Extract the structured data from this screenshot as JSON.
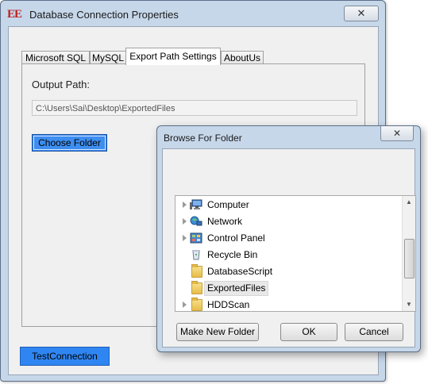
{
  "window": {
    "title": "Database Connection Properties",
    "app_icon_text": "EE",
    "close_glyph": "✕"
  },
  "tabs": [
    {
      "label": "Microsoft SQL"
    },
    {
      "label": "MySQL"
    },
    {
      "label": "Export Path Settings"
    },
    {
      "label": "AboutUs"
    }
  ],
  "export_panel": {
    "output_label": "Output Path:",
    "output_path": "C:\\Users\\Sai\\Desktop\\ExportedFiles",
    "choose_button": "Choose Folder"
  },
  "test_button": "TestConnection",
  "browse_dialog": {
    "title": "Browse For Folder",
    "close_glyph": "✕",
    "tree": [
      {
        "label": "Computer",
        "icon": "computer-icon",
        "expander": true
      },
      {
        "label": "Network",
        "icon": "network-icon",
        "expander": true
      },
      {
        "label": "Control Panel",
        "icon": "control-panel-icon",
        "expander": true
      },
      {
        "label": "Recycle Bin",
        "icon": "recycle-bin-icon",
        "expander": false
      },
      {
        "label": "DatabaseScript",
        "icon": "folder-icon",
        "expander": false
      },
      {
        "label": "ExportedFiles",
        "icon": "folder-icon",
        "expander": false,
        "selected": true
      },
      {
        "label": "HDDScan",
        "icon": "folder-icon",
        "expander": true
      }
    ],
    "buttons": {
      "new_folder": "Make New Folder",
      "ok": "OK",
      "cancel": "Cancel"
    }
  },
  "colors": {
    "window_frame": "#c6d7ea",
    "button_blue": "#3d8ef0"
  }
}
